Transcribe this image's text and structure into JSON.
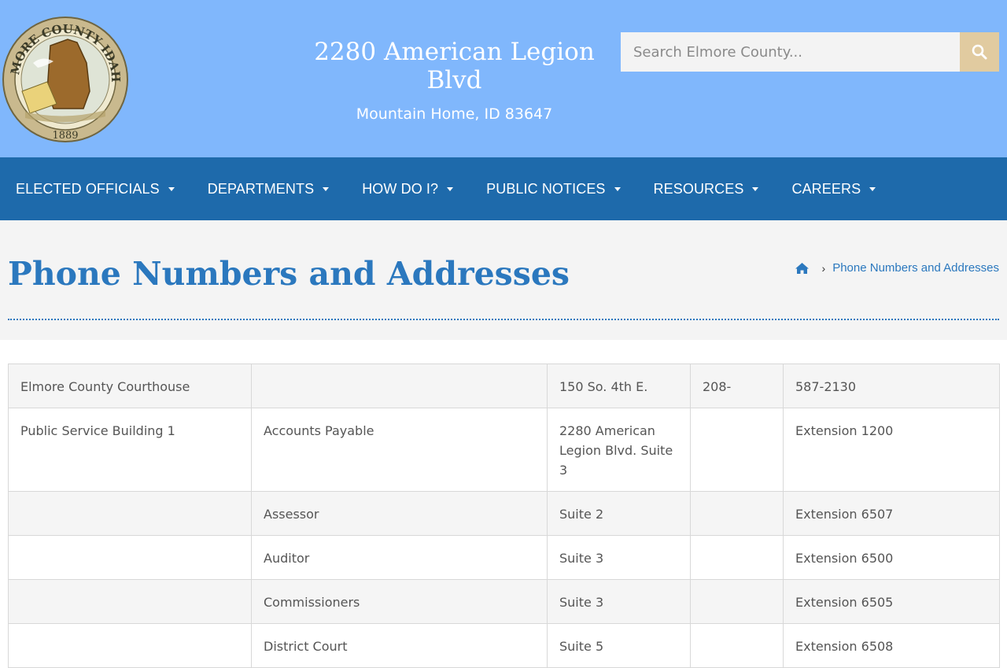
{
  "header": {
    "address_line1": "2280 American Legion Blvd",
    "address_line2": "Mountain Home, ID 83647",
    "search_placeholder": "Search Elmore County...",
    "seal": {
      "text_top": "ELMORE COUNTY IDAHO",
      "year": "1889"
    }
  },
  "nav": {
    "items": [
      {
        "label": "ELECTED OFFICIALS"
      },
      {
        "label": "DEPARTMENTS"
      },
      {
        "label": "HOW DO I?"
      },
      {
        "label": "PUBLIC NOTICES"
      },
      {
        "label": "RESOURCES"
      },
      {
        "label": "CAREERS"
      }
    ]
  },
  "page": {
    "title": "Phone Numbers and Addresses",
    "breadcrumb_current": "Phone Numbers and Addresses"
  },
  "table": {
    "rows": [
      [
        "Elmore County Courthouse",
        "",
        "150 So. 4th E.",
        "208-",
        "587-2130"
      ],
      [
        "Public Service Building 1",
        "Accounts Payable",
        "2280 American Legion Blvd. Suite 3",
        "",
        "Extension 1200"
      ],
      [
        "",
        "Assessor",
        "Suite 2",
        "",
        "Extension 6507"
      ],
      [
        "",
        "Auditor",
        "Suite 3",
        "",
        "Extension 6500"
      ],
      [
        "",
        "Commissioners",
        "Suite 3",
        "",
        "Extension 6505"
      ],
      [
        "",
        "District Court",
        "Suite 5",
        "",
        "Extension 6508"
      ]
    ]
  },
  "colors": {
    "header_bg": "#80b7fc",
    "nav_bg": "#1e6aab",
    "accent": "#2b78be",
    "search_button": "#e1cba0"
  }
}
